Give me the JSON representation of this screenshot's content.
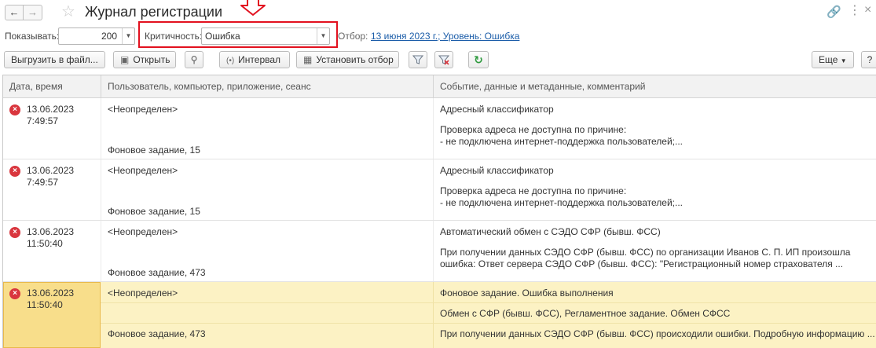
{
  "window": {
    "title": "Журнал регистрации"
  },
  "filter": {
    "show_label": "Показывать:",
    "show_value": "200",
    "criticality_label": "Критичность:",
    "criticality_value": "Ошибка",
    "selection_label": "Отбор:",
    "selection_link": "13 июня 2023 г.; Уровень: Ошибка"
  },
  "toolbar": {
    "export_label": "Выгрузить в файл...",
    "open_label": "Открыть",
    "interval_label": "Интервал",
    "set_filter_label": "Установить отбор",
    "more_label": "Еще",
    "help_label": "?"
  },
  "columns": [
    "Дата, время",
    "Пользователь, компьютер, приложение, сеанс",
    "Событие, данные и метаданные, комментарий"
  ],
  "rows": [
    {
      "date": "13.06.2023",
      "time": "7:49:57",
      "user": "<Неопределен>",
      "session": "Фоновое задание, 15",
      "event": "Адресный классификатор",
      "details1": "Проверка адреса не доступна по причине:",
      "details2": "- не подключена интернет-поддержка пользователей;..."
    },
    {
      "date": "13.06.2023",
      "time": "7:49:57",
      "user": "<Неопределен>",
      "session": "Фоновое задание, 15",
      "event": "Адресный классификатор",
      "details1": "Проверка адреса не доступна по причине:",
      "details2": "- не подключена интернет-поддержка пользователей;..."
    },
    {
      "date": "13.06.2023",
      "time": "11:50:40",
      "user": "<Неопределен>",
      "session": "Фоновое задание, 473",
      "event": "Автоматический обмен с СЭДО СФР (бывш. ФСС)",
      "details1": "При получении данных СЭДО СФР (бывш. ФСС) по организации Иванов С. П. ИП произошла",
      "details2": "ошибка: Ответ сервера СЭДО СФР (бывш. ФСС): \"Регистрационный номер страхователя ..."
    },
    {
      "date": "13.06.2023",
      "time": "11:50:40",
      "user": "<Неопределен>",
      "session": "Фоновое задание, 473",
      "event": "Фоновое задание. Ошибка выполнения",
      "details1": "Обмен с СФР (бывш. ФСС), Регламентное задание. Обмен СФСС",
      "details2": "При получении данных СЭДО СФР (бывш. ФСС) происходили ошибки. Подробную информацию ..."
    }
  ],
  "colors": {
    "error": "#d9363e",
    "selected_row": "#fcf2c4",
    "highlight_frame": "#e2111f",
    "link": "#1a5ca8"
  }
}
